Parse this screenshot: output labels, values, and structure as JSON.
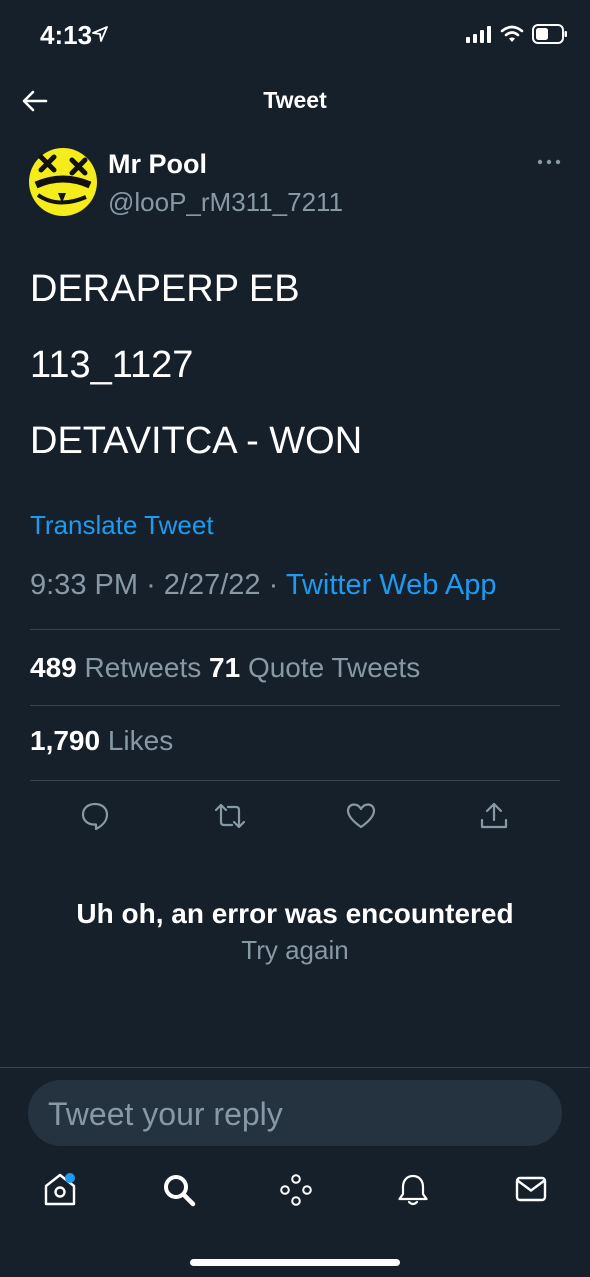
{
  "status_bar": {
    "time": "4:13"
  },
  "header": {
    "title": "Tweet"
  },
  "author": {
    "display_name": "Mr Pool",
    "handle": "@looP_rM311_7211"
  },
  "tweet": {
    "lines": [
      "DERAPERP EB",
      "113_1127",
      "DETAVITCA - WON"
    ],
    "translate_label": "Translate Tweet",
    "time": "9:33 PM",
    "separator": "·",
    "date": "2/27/22",
    "source": "Twitter Web App"
  },
  "stats": {
    "retweets_count": "489",
    "retweets_label": "Retweets",
    "quotes_count": "71",
    "quotes_label": "Quote Tweets",
    "likes_count": "1,790",
    "likes_label": "Likes"
  },
  "error": {
    "title": "Uh oh, an error was encountered",
    "retry_label": "Try again"
  },
  "reply": {
    "placeholder": "Tweet your reply"
  },
  "colors": {
    "background": "#15202b",
    "accent": "#1d9bf0",
    "muted": "#8899a6",
    "divider": "#38444d"
  },
  "icons": [
    "location-arrow-icon",
    "signal-icon",
    "wifi-icon",
    "battery-icon",
    "back-arrow-icon",
    "more-icon",
    "reply-icon",
    "retweet-icon",
    "like-icon",
    "share-icon",
    "home-icon",
    "search-icon",
    "spaces-icon",
    "notifications-icon",
    "messages-icon"
  ]
}
